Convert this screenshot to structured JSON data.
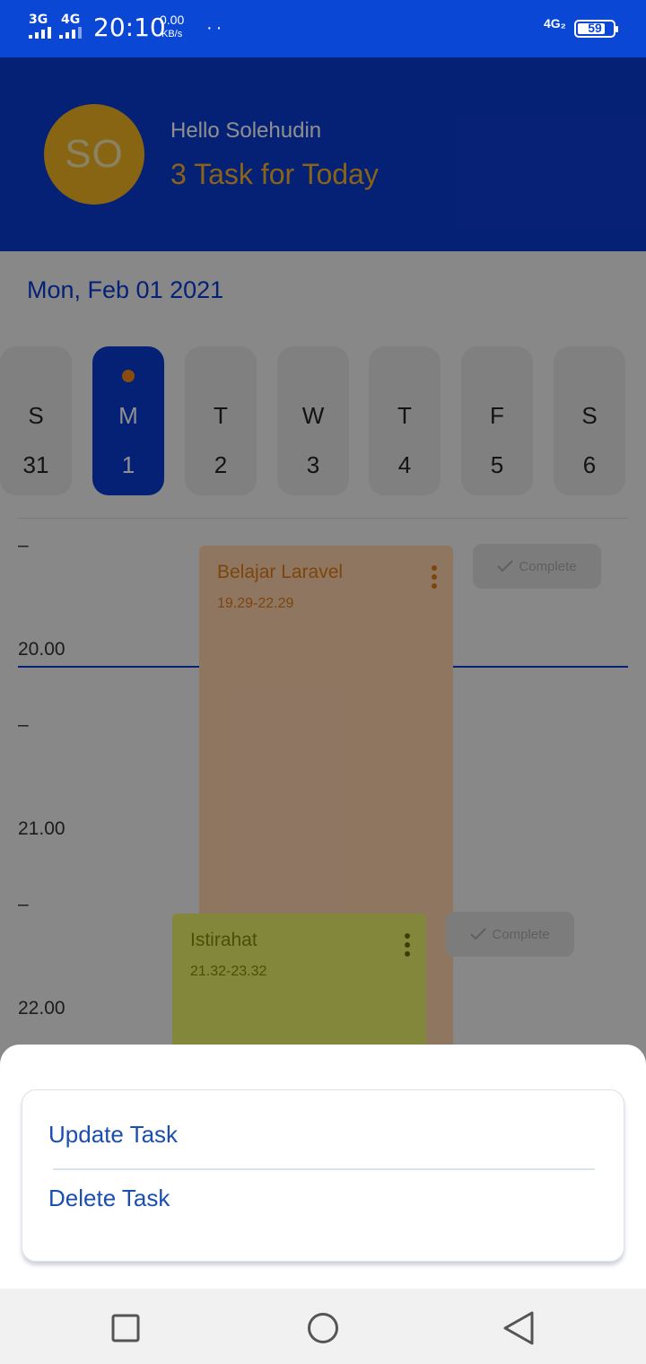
{
  "status_bar": {
    "net1": "3G",
    "net2": "4G",
    "time": "20:10",
    "speed_value": "0.00",
    "speed_unit": "KB/s",
    "dots": "··",
    "net_right": "4G₂",
    "battery": "59"
  },
  "header": {
    "avatar_initials": "SO",
    "greeting": "Hello Solehudin",
    "task_summary": "3 Task for Today"
  },
  "date_title": "Mon, Feb 01 2021",
  "week": [
    {
      "letter": "S",
      "num": "31",
      "active": false
    },
    {
      "letter": "M",
      "num": "1",
      "active": true
    },
    {
      "letter": "T",
      "num": "2",
      "active": false
    },
    {
      "letter": "W",
      "num": "3",
      "active": false
    },
    {
      "letter": "T",
      "num": "4",
      "active": false
    },
    {
      "letter": "F",
      "num": "5",
      "active": false
    },
    {
      "letter": "S",
      "num": "6",
      "active": false
    }
  ],
  "timeline": {
    "labels": [
      "–",
      "20.00",
      "–",
      "21.00",
      "–",
      "22.00"
    ]
  },
  "tasks": [
    {
      "title": "Belajar Laravel",
      "time": "19.29-22.29",
      "complete_label": "Complete"
    },
    {
      "title": "Istirahat",
      "time": "21.32-23.32",
      "complete_label": "Complete"
    }
  ],
  "sheet": {
    "update_label": "Update Task",
    "delete_label": "Delete Task"
  },
  "colors": {
    "status_bar": "#0a47d4",
    "header": "#0a3bd0",
    "accent": "#f5b32a",
    "task1_bg": "#fdd3ae",
    "task2_bg": "#e8f06a",
    "action_text": "#1a4fb0"
  },
  "icons": [
    "check-icon",
    "more-vert-icon",
    "recents-square-icon",
    "home-circle-icon",
    "back-triangle-icon",
    "battery-icon"
  ]
}
